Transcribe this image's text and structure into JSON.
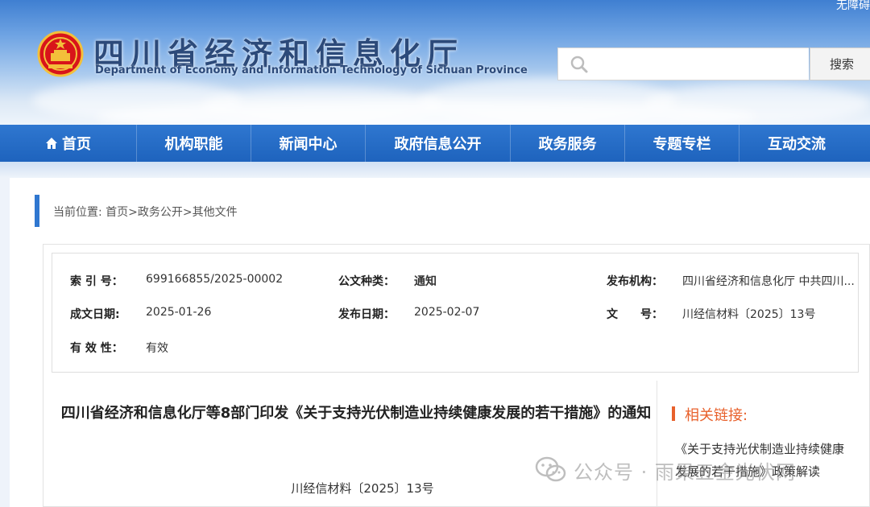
{
  "header": {
    "accessible_link": "无障碍",
    "site_title_cn": "四川省经济和信息化厅",
    "site_title_en": "Department of Economy and Information Technology of Sichuan Province",
    "search": {
      "placeholder": "",
      "value": "",
      "button_label": "搜索"
    }
  },
  "nav": {
    "items": [
      {
        "label": "首页",
        "icon": "home-icon"
      },
      {
        "label": "机构职能"
      },
      {
        "label": "新闻中心"
      },
      {
        "label": "政府信息公开"
      },
      {
        "label": "政务服务"
      },
      {
        "label": "专题专栏"
      },
      {
        "label": "互动交流"
      }
    ]
  },
  "breadcrumb": {
    "prefix": "当前位置:",
    "items": [
      "首页",
      "政务公开",
      "其他文件"
    ],
    "separator": ">"
  },
  "meta": {
    "index_no_label": "索 引 号：",
    "index_no": "699166855/2025-00002",
    "doc_type_label": "公文种类：",
    "doc_type": "通知",
    "issuer_label": "发布机构：",
    "issuer": "四川省经济和信息化厅 中共四川...",
    "created_label": "成文日期:",
    "created": "2025-01-26",
    "published_label": "发布日期：",
    "published": "2025-02-07",
    "number_label": "文　　号：",
    "number": "川经信材料〔2025〕13号",
    "validity_label": "有 效 性：",
    "validity": "有效"
  },
  "document": {
    "title": "四川省经济和信息化厅等8部门印发《关于支持光伏制造业持续健康发展的若干措施》的通知",
    "doc_number": "川经信材料〔2025〕13号"
  },
  "related": {
    "title": "相关链接:",
    "links": [
      "《关于支持光伏制造业持续健康发展的若干措施》政策解读"
    ]
  },
  "watermark": {
    "text": "公众号 · 雨果五金光伏网"
  },
  "colors": {
    "nav_blue": "#1e63bd",
    "accent_orange": "#e8612c",
    "title_blue": "#2c4a7a"
  }
}
